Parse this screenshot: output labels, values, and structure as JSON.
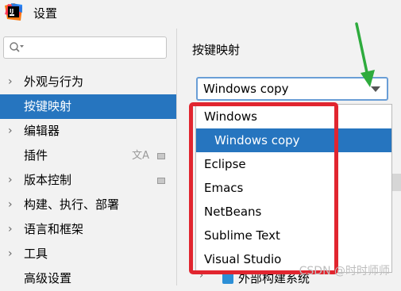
{
  "window": {
    "title": "设置"
  },
  "sidebar": {
    "search": {
      "placeholder": ""
    },
    "items": [
      {
        "label": "外观与行为",
        "expandable": true
      },
      {
        "label": "按键映射",
        "expandable": false,
        "selected": true
      },
      {
        "label": "编辑器",
        "expandable": true
      },
      {
        "label": "插件",
        "expandable": false,
        "badges": [
          "translate-icon",
          "box-icon"
        ]
      },
      {
        "label": "版本控制",
        "expandable": true,
        "badges": [
          "box-icon"
        ]
      },
      {
        "label": "构建、执行、部署",
        "expandable": true
      },
      {
        "label": "语言和框架",
        "expandable": true
      },
      {
        "label": "工具",
        "expandable": true
      },
      {
        "label": "高级设置",
        "expandable": false
      }
    ]
  },
  "main": {
    "section_title": "按键映射",
    "keymap_combo": {
      "value": "Windows copy"
    },
    "dropdown": {
      "options": [
        {
          "label": "Windows",
          "indent": false,
          "selected": false
        },
        {
          "label": "Windows copy",
          "indent": true,
          "selected": true
        },
        {
          "label": "Eclipse",
          "indent": false,
          "selected": false
        },
        {
          "label": "Emacs",
          "indent": false,
          "selected": false
        },
        {
          "label": "NetBeans",
          "indent": false,
          "selected": false
        },
        {
          "label": "Sublime Text",
          "indent": false,
          "selected": false
        },
        {
          "label": "Visual Studio",
          "indent": false,
          "selected": false
        }
      ]
    },
    "tree_partial_label": "外部构建系统"
  },
  "watermark": "CSDN @时时师师",
  "colors": {
    "selection": "#2675bf",
    "annotation_red": "#e1252f",
    "annotation_green": "#2eab3d"
  }
}
